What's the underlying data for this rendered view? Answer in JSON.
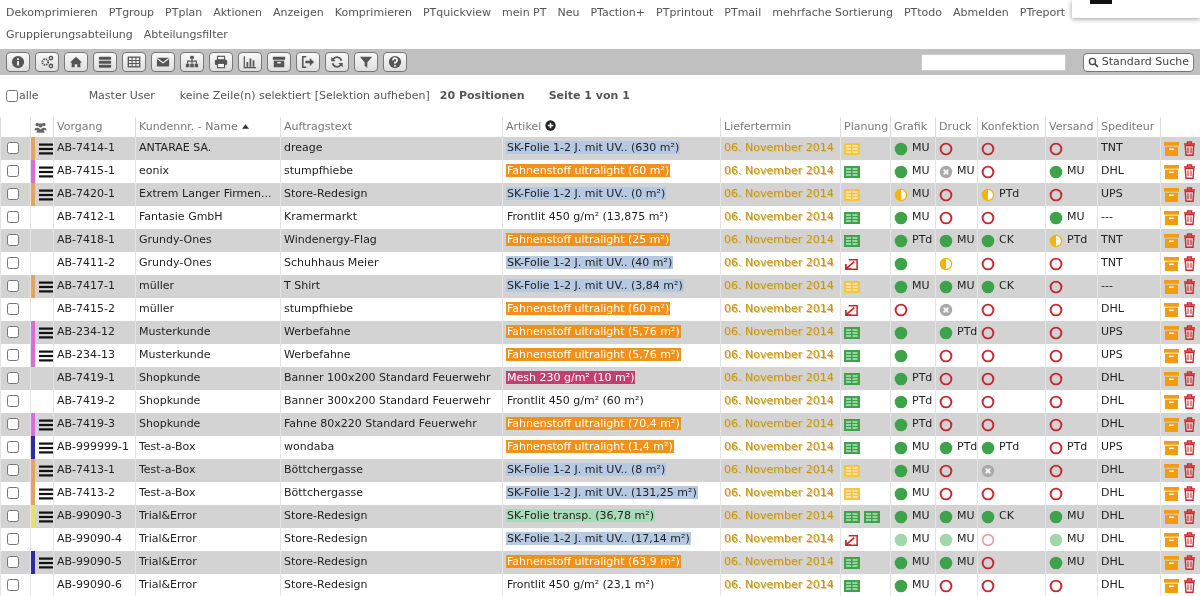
{
  "menu": [
    "Dekomprimieren",
    "PTgroup",
    "PTplan",
    "Aktionen",
    "Anzeigen",
    "Komprimieren",
    "PTquickview",
    "mein PT",
    "Neu",
    "PTaction+",
    "PTprintout",
    "PTmail",
    "mehrfache Sortierung",
    "PTtodo",
    "Abmelden",
    "PTreport",
    "Gruppierungsabteilung",
    "Abteilungsfilter"
  ],
  "toolbar": {
    "search_button": "Standard Suche"
  },
  "selection": {
    "all_label": "alle",
    "all_checked": false,
    "user": "Master User",
    "status": "keine Zeile(n) selektiert",
    "clear_link": "[Selektion aufheben]",
    "count": "20 Positionen",
    "page": "Seite 1 von 1"
  },
  "table": {
    "columns": [
      {
        "label": "Vorgang",
        "kind": "plain"
      },
      {
        "label": "Kundennr. - Name",
        "kind": "sorted"
      },
      {
        "label": "Auftragstext",
        "kind": "plain"
      },
      {
        "label": "Artikel",
        "kind": "expandable"
      },
      {
        "label": "Liefertermin",
        "kind": "plain"
      },
      {
        "label": "Planung",
        "kind": "plain"
      },
      {
        "label": "Grafik",
        "kind": "plain"
      },
      {
        "label": "Druck",
        "kind": "plain"
      },
      {
        "label": "Konfektion",
        "kind": "plain"
      },
      {
        "label": "Versand",
        "kind": "plain"
      },
      {
        "label": "Spediteur",
        "kind": "plain"
      }
    ],
    "rows": [
      {
        "selected": false,
        "color": "#e0a464",
        "vorgang": "AB-7414-1",
        "kunde": "ANTARAE SA.",
        "auftrag": "dreage",
        "artikel": {
          "text": "SK-Folie 1-2 J. mit UV.. (630 m²)",
          "color": "#b6c9e3"
        },
        "termin": "06. November 2014",
        "planung": [
          {
            "kind": "bars",
            "color": "#f5c542"
          }
        ],
        "grafik": {
          "kind": "done",
          "label": "MU"
        },
        "druck": {
          "kind": "open"
        },
        "konfektion": {
          "kind": "open"
        },
        "versand": {
          "kind": "open"
        },
        "spediteur": "TNT"
      },
      {
        "selected": false,
        "color": "#d66fd6",
        "vorgang": "AB-7415-1",
        "kunde": "eonix",
        "auftrag": "stumpfhiebe",
        "artikel": {
          "text": "Fahnenstoff ultralight (60 m²)",
          "color": "#f0921a"
        },
        "termin": "06. November 2014",
        "planung": [
          {
            "kind": "bars",
            "color": "#3da24a"
          }
        ],
        "grafik": {
          "kind": "done",
          "label": "MU"
        },
        "druck": {
          "kind": "cancelled",
          "label": "MU"
        },
        "konfektion": {
          "kind": "open"
        },
        "versand": {
          "kind": "done",
          "label": "MU"
        },
        "spediteur": "DHL"
      },
      {
        "selected": false,
        "color": "#e0a464",
        "vorgang": "AB-7420-1",
        "kunde": "Extrem Langer Firmen...",
        "auftrag": "Store-Redesign",
        "artikel": {
          "text": "SK-Folie 1-2 J. mit UV.. (0 m²)",
          "color": "#b6c9e3"
        },
        "termin": "06. November 2014",
        "planung": [
          {
            "kind": "bars",
            "color": "#f5c542"
          }
        ],
        "grafik": {
          "kind": "half",
          "label": "MU"
        },
        "druck": {
          "kind": "open"
        },
        "konfektion": {
          "kind": "half",
          "label": "PTd"
        },
        "versand": {
          "kind": "open"
        },
        "spediteur": "UPS"
      },
      {
        "selected": false,
        "vorgang": "AB-7412-1",
        "kunde": "Fantasie GmbH",
        "auftrag": "Kramermarkt",
        "artikel": {
          "text": "Frontlit 450 g/m² (13,875 m²)"
        },
        "termin": "06. November 2014",
        "planung": [
          {
            "kind": "bars",
            "color": "#3da24a"
          }
        ],
        "grafik": {
          "kind": "done",
          "label": "MU"
        },
        "druck": {
          "kind": "open"
        },
        "konfektion": {
          "kind": "open"
        },
        "versand": {
          "kind": "done",
          "label": "MU"
        },
        "spediteur": "---"
      },
      {
        "selected": false,
        "vorgang": "AB-7418-1",
        "kunde": "Grundy-Ones",
        "auftrag": "Windenergy-Flag",
        "artikel": {
          "text": "Fahnenstoff ultralight (25 m²)",
          "color": "#f0921a"
        },
        "termin": "06. November 2014",
        "planung": [
          {
            "kind": "bars",
            "color": "#3da24a"
          }
        ],
        "grafik": {
          "kind": "done",
          "label": "PTd"
        },
        "druck": {
          "kind": "done",
          "label": "MU"
        },
        "konfektion": {
          "kind": "done",
          "label": "CK"
        },
        "versand": {
          "kind": "half",
          "label": "PTd"
        },
        "spediteur": "TNT"
      },
      {
        "selected": false,
        "vorgang": "AB-7411-2",
        "kunde": "Grundy-Ones",
        "auftrag": "Schuhhaus Meier",
        "artikel": {
          "text": "SK-Folie 1-2 J. mit UV.. (40 m²)",
          "color": "#b6c9e3"
        },
        "termin": "06. November 2014",
        "planung": [
          {
            "kind": "return"
          }
        ],
        "grafik": {
          "kind": "done"
        },
        "druck": {
          "kind": "half"
        },
        "konfektion": {
          "kind": "open"
        },
        "versand": {
          "kind": "open"
        },
        "spediteur": "TNT"
      },
      {
        "selected": false,
        "color": "#e0a464",
        "vorgang": "AB-7417-1",
        "kunde": "müller",
        "auftrag": "T Shirt",
        "artikel": {
          "text": "SK-Folie 1-2 J. mit UV.. (3,84 m²)",
          "color": "#b6c9e3"
        },
        "termin": "06. November 2014",
        "planung": [
          {
            "kind": "bars",
            "color": "#f5c542"
          }
        ],
        "grafik": {
          "kind": "done",
          "label": "MU"
        },
        "druck": {
          "kind": "done",
          "label": "MU"
        },
        "konfektion": {
          "kind": "done",
          "label": "CK"
        },
        "versand": {
          "kind": "open"
        },
        "spediteur": "---"
      },
      {
        "selected": false,
        "vorgang": "AB-7415-2",
        "kunde": "müller",
        "auftrag": "stumpfhiebe",
        "artikel": {
          "text": "Fahnenstoff ultralight (60 m²)",
          "color": "#f0921a"
        },
        "termin": "06. November 2014",
        "planung": [
          {
            "kind": "return"
          }
        ],
        "grafik": {
          "kind": "open"
        },
        "druck": {
          "kind": "cancelled"
        },
        "konfektion": {
          "kind": "open"
        },
        "versand": {
          "kind": "open"
        },
        "spediteur": "DHL"
      },
      {
        "selected": false,
        "color": "#d66fd6",
        "vorgang": "AB-234-12",
        "kunde": "Musterkunde",
        "auftrag": "Werbefahne",
        "artikel": {
          "text": "Fahnenstoff ultralight (5,76 m²)",
          "color": "#f0921a"
        },
        "termin": "06. November 2014",
        "planung": [
          {
            "kind": "bars",
            "color": "#3da24a"
          }
        ],
        "grafik": {
          "kind": "done"
        },
        "druck": {
          "kind": "done",
          "label": "PTd"
        },
        "konfektion": {
          "kind": "open"
        },
        "versand": {
          "kind": "open"
        },
        "spediteur": "UPS"
      },
      {
        "selected": false,
        "color": "#d66fd6",
        "vorgang": "AB-234-13",
        "kunde": "Musterkunde",
        "auftrag": "Werbefahne",
        "artikel": {
          "text": "Fahnenstoff ultralight (5,76 m²)",
          "color": "#f0921a"
        },
        "termin": "06. November 2014",
        "planung": [
          {
            "kind": "bars",
            "color": "#3da24a"
          }
        ],
        "grafik": {
          "kind": "done"
        },
        "druck": {
          "kind": "open"
        },
        "konfektion": {
          "kind": "open"
        },
        "versand": {
          "kind": "open"
        },
        "spediteur": "UPS"
      },
      {
        "selected": false,
        "vorgang": "AB-7419-1",
        "kunde": "Shopkunde",
        "auftrag": "Banner 100x200 Standard Feuerwehr",
        "artikel": {
          "text": "Mesh 230 g/m² (10 m²)",
          "color": "#c2406e"
        },
        "termin": "06. November 2014",
        "planung": [
          {
            "kind": "bars",
            "color": "#3da24a"
          }
        ],
        "grafik": {
          "kind": "done",
          "label": "PTd"
        },
        "druck": {
          "kind": "open"
        },
        "konfektion": {
          "kind": "open"
        },
        "versand": {
          "kind": "open"
        },
        "spediteur": "DHL"
      },
      {
        "selected": false,
        "vorgang": "AB-7419-2",
        "kunde": "Shopkunde",
        "auftrag": "Banner 300x200 Standard Feuerwehr",
        "artikel": {
          "text": "Frontlit 450 g/m² (60 m²)"
        },
        "termin": "06. November 2014",
        "planung": [
          {
            "kind": "bars",
            "color": "#3da24a"
          }
        ],
        "grafik": {
          "kind": "done",
          "label": "PTd"
        },
        "druck": {
          "kind": "open"
        },
        "konfektion": {
          "kind": "open"
        },
        "versand": {
          "kind": "open"
        },
        "spediteur": "DHL"
      },
      {
        "selected": false,
        "color": "#d66fd6",
        "vorgang": "AB-7419-3",
        "kunde": "Shopkunde",
        "auftrag": "Fahne 80x220 Standard Feuerwehr",
        "artikel": {
          "text": "Fahnenstoff ultralight (70,4 m²)",
          "color": "#f0921a"
        },
        "termin": "06. November 2014",
        "planung": [
          {
            "kind": "bars",
            "color": "#3da24a"
          }
        ],
        "grafik": {
          "kind": "done",
          "label": "PTd"
        },
        "druck": {
          "kind": "open"
        },
        "konfektion": {
          "kind": "open"
        },
        "versand": {
          "kind": "open"
        },
        "spediteur": "DHL"
      },
      {
        "selected": false,
        "color": "#2c2c9e",
        "vorgang": "AB-999999-1",
        "kunde": "Test-a-Box",
        "auftrag": "wondaba",
        "artikel": {
          "text": "Fahnenstoff ultralight (1,4 m²)",
          "color": "#f0921a"
        },
        "termin": "06. November 2014",
        "planung": [
          {
            "kind": "bars",
            "color": "#3da24a"
          }
        ],
        "grafik": {
          "kind": "done",
          "label": "MU"
        },
        "druck": {
          "kind": "done",
          "label": "PTd"
        },
        "konfektion": {
          "kind": "done",
          "label": "PTd"
        },
        "versand": {
          "kind": "open",
          "label": "PTd"
        },
        "spediteur": "UPS"
      },
      {
        "selected": false,
        "color": "#e0a464",
        "vorgang": "AB-7413-1",
        "kunde": "Test-a-Box",
        "auftrag": "Böttchergasse",
        "artikel": {
          "text": "SK-Folie 1-2 J. mit UV.. (8 m²)",
          "color": "#b6c9e3"
        },
        "termin": "06. November 2014",
        "planung": [
          {
            "kind": "bars",
            "color": "#f5c542"
          }
        ],
        "grafik": {
          "kind": "done",
          "label": "MU"
        },
        "druck": {
          "kind": "open"
        },
        "konfektion": {
          "kind": "cancelled"
        },
        "versand": {
          "kind": "open"
        },
        "spediteur": "DHL"
      },
      {
        "selected": false,
        "color": "#e0a464",
        "vorgang": "AB-7413-2",
        "kunde": "Test-a-Box",
        "auftrag": "Böttchergasse",
        "artikel": {
          "text": "SK-Folie 1-2 J. mit UV.. (131,25 m²)",
          "color": "#b6c9e3"
        },
        "termin": "06. November 2014",
        "planung": [
          {
            "kind": "bars",
            "color": "#f5c542"
          }
        ],
        "grafik": {
          "kind": "done",
          "label": "MU"
        },
        "druck": {
          "kind": "open"
        },
        "konfektion": {
          "kind": "open"
        },
        "versand": {
          "kind": "open"
        },
        "spediteur": "DHL"
      },
      {
        "selected": false,
        "color": "#e6e070",
        "vorgang": "AB-99090-3",
        "kunde": "Trial&Error",
        "auftrag": "Store-Redesign",
        "artikel": {
          "text": "SK-Folie transp. (36,78 m²)",
          "color": "#a9dbb8"
        },
        "termin": "06. November 2014",
        "planung": [
          {
            "kind": "bars",
            "color": "#3da24a"
          },
          {
            "kind": "bars",
            "color": "#3da24a"
          }
        ],
        "grafik": {
          "kind": "done",
          "label": "MU"
        },
        "druck": {
          "kind": "done",
          "label": "MU"
        },
        "konfektion": {
          "kind": "done",
          "label": "CK"
        },
        "versand": {
          "kind": "done",
          "label": "MU"
        },
        "spediteur": "DHL"
      },
      {
        "selected": false,
        "vorgang": "AB-99090-4",
        "kunde": "Trial&Error",
        "auftrag": "Store-Redesign",
        "artikel": {
          "text": "SK-Folie 1-2 J. mit UV.. (17,14 m²)",
          "color": "#b6c9e3"
        },
        "termin": "06. November 2014",
        "planung": [
          {
            "kind": "return"
          }
        ],
        "grafik": {
          "kind": "done-light",
          "label": "MU"
        },
        "druck": {
          "kind": "done-light",
          "label": "MU"
        },
        "konfektion": {
          "kind": "open-light"
        },
        "versand": {
          "kind": "done-light",
          "label": "MU"
        },
        "spediteur": "DHL"
      },
      {
        "selected": false,
        "color": "#2c2c9e",
        "vorgang": "AB-99090-5",
        "kunde": "Trial&Error",
        "auftrag": "Store-Redesign",
        "artikel": {
          "text": "Fahnenstoff ultralight (63,9 m²)",
          "color": "#f0921a"
        },
        "termin": "06. November 2014",
        "planung": [
          {
            "kind": "bars",
            "color": "#3da24a"
          }
        ],
        "grafik": {
          "kind": "done",
          "label": "MU"
        },
        "druck": {
          "kind": "done",
          "label": "MU"
        },
        "konfektion": {
          "kind": "open"
        },
        "versand": {
          "kind": "done",
          "label": "MU"
        },
        "spediteur": "DHL"
      },
      {
        "selected": false,
        "vorgang": "AB-99090-6",
        "kunde": "Trial&Error",
        "auftrag": "Store-Redesign",
        "artikel": {
          "text": "Frontlit 450 g/m² (23,1 m²)"
        },
        "termin": "06. November 2014",
        "planung": [
          {
            "kind": "bars",
            "color": "#3da24a"
          }
        ],
        "grafik": {
          "kind": "done",
          "label": "MU"
        },
        "druck": {
          "kind": "open"
        },
        "konfektion": {
          "kind": "open"
        },
        "versand": {
          "kind": "open"
        },
        "spediteur": "DHL"
      }
    ]
  }
}
